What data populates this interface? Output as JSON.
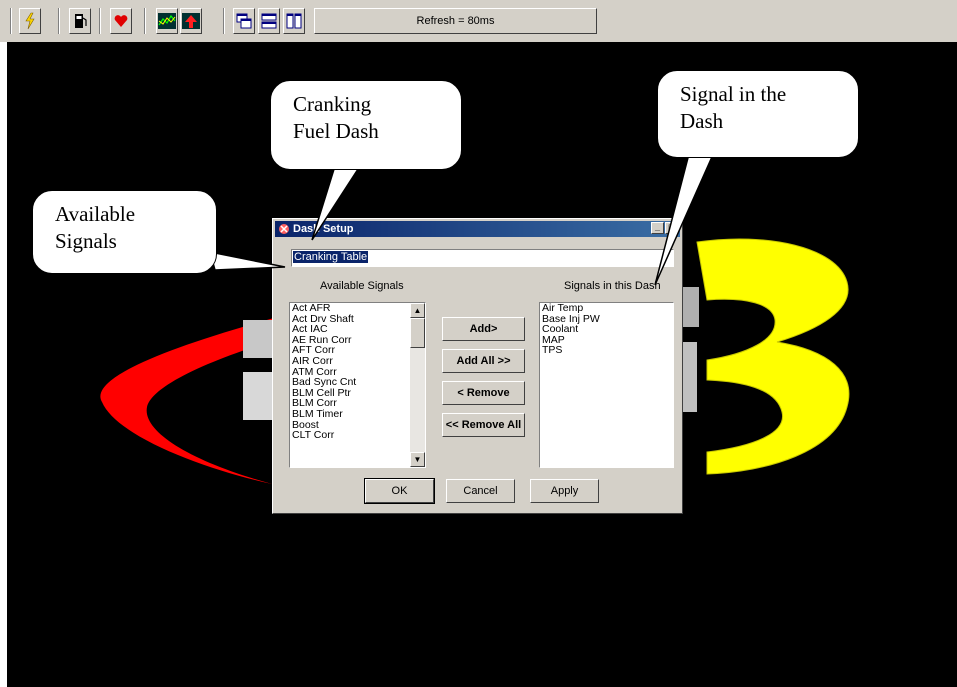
{
  "toolbar": {
    "refresh_label": "Refresh = 80ms"
  },
  "dialog": {
    "title": "Dash Setup",
    "dash_name_value": "Cranking Table",
    "available_label": "Available Signals",
    "in_dash_label": "Signals in this Dash",
    "available_signals": [
      "Act AFR",
      "Act Drv Shaft",
      "Act IAC",
      "AE Run Corr",
      "AFT Corr",
      "AIR Corr",
      "ATM Corr",
      "Bad Sync Cnt",
      "BLM Cell Ptr",
      "BLM Corr",
      "BLM Timer",
      "Boost",
      "CLT Corr"
    ],
    "dash_signals": [
      "Air Temp",
      "Base Inj PW",
      "Coolant",
      "MAP",
      "TPS"
    ],
    "buttons": {
      "add": "Add>",
      "add_all": "Add All >>",
      "remove": "< Remove",
      "remove_all": "<< Remove All",
      "ok": "OK",
      "cancel": "Cancel",
      "apply": "Apply"
    }
  },
  "callouts": {
    "cranking": "Cranking Fuel Dash",
    "available": "Available Signals",
    "signal": "Signal in the Dash"
  },
  "colors": {
    "logo_red": "#ff0000",
    "logo_yellow": "#ffff00",
    "titlebar": "#0a246a"
  }
}
